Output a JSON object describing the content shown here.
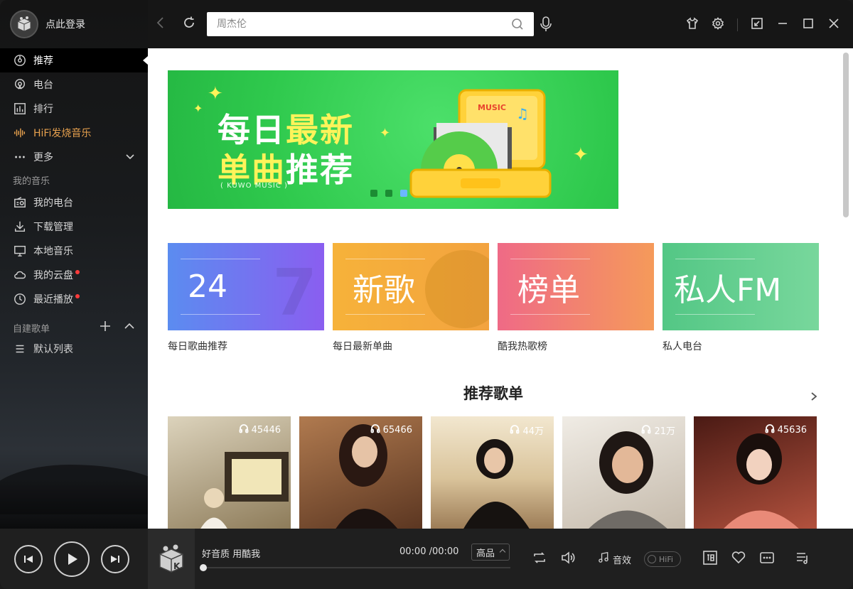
{
  "user": {
    "login_label": "点此登录"
  },
  "search": {
    "placeholder": "周杰伦"
  },
  "sidebar": {
    "items": [
      {
        "label": "推荐",
        "icon": "disc-icon",
        "active": true
      },
      {
        "label": "电台",
        "icon": "radio-icon"
      },
      {
        "label": "排行",
        "icon": "chart-icon"
      },
      {
        "label": "HiFi发烧音乐",
        "icon": "soundwave-icon",
        "hifi": true
      },
      {
        "label": "更多",
        "icon": "more-dots-icon"
      }
    ],
    "my_music_title": "我的音乐",
    "my_music": [
      {
        "label": "我的电台",
        "icon": "radio-box-icon"
      },
      {
        "label": "下载管理",
        "icon": "download-icon"
      },
      {
        "label": "本地音乐",
        "icon": "monitor-icon"
      },
      {
        "label": "我的云盘",
        "icon": "cloud-icon",
        "dot": true
      },
      {
        "label": "最近播放",
        "icon": "clock-icon",
        "dot": true
      }
    ],
    "playlists_title": "自建歌单",
    "playlists": [
      {
        "label": "默认列表",
        "icon": "list-icon"
      }
    ]
  },
  "banner": {
    "line1_white": "每日",
    "line1_yellow": "最新",
    "line2_yellow": "单曲",
    "line2_white": "推荐",
    "sub": "( KUWO MUSIC )",
    "box_label": "MUSIC",
    "dots": 3,
    "active_dot": 2
  },
  "cards": [
    {
      "big": "24",
      "caption": "每日歌曲推荐",
      "gradient": [
        "#5b8cf0",
        "#8a5ef0"
      ],
      "ghost": "7"
    },
    {
      "big": "新歌",
      "caption": "每日最新单曲",
      "gradient": [
        "#f6b23a",
        "#f3a33f"
      ],
      "ghost": ""
    },
    {
      "big": "榜单",
      "caption": "酷我热歌榜",
      "gradient": [
        "#ef6a86",
        "#f59a5a"
      ],
      "ghost": ""
    },
    {
      "big": "私人FM",
      "caption": "私人电台",
      "gradient": [
        "#53c785",
        "#78d79c"
      ],
      "ghost": ""
    }
  ],
  "section": {
    "title": "推荐歌单"
  },
  "playlists": [
    {
      "count": "45446",
      "bg": [
        "#cfc3a6",
        "#7a6a4c"
      ]
    },
    {
      "count": "65466",
      "bg": [
        "#9c6b45",
        "#5a3420"
      ]
    },
    {
      "count": "44万",
      "bg": [
        "#e8d7b4",
        "#8c6a44"
      ]
    },
    {
      "count": "21万",
      "bg": [
        "#e9e4dc",
        "#b5aa9c"
      ]
    },
    {
      "count": "45636",
      "bg": [
        "#5a1f18",
        "#c25a44"
      ]
    }
  ],
  "player": {
    "song": "好音质 用酷我",
    "time": "00:00 /00:00",
    "quality": "高品",
    "effect_label": "音效",
    "hifi_label": "HiFi",
    "progress": 0
  }
}
